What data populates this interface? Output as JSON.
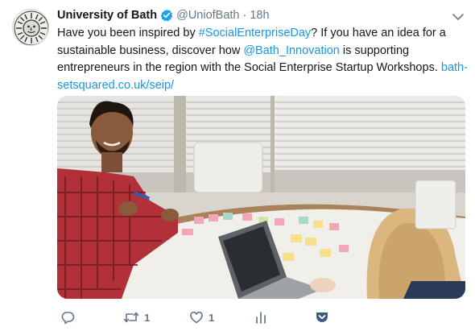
{
  "tweet": {
    "author_name": "University of Bath",
    "handle": "@UniofBath",
    "separator": "·",
    "time": "18h",
    "text": {
      "p1": "Have you been inspired by ",
      "hashtag": "#SocialEnterpriseDay",
      "p2": "? If you have an idea for a sustainable business, discover how ",
      "mention": "@Bath_Innovation",
      "p3": " is supporting entrepreneurs in the region with the Social Enterprise Startup Workshops. ",
      "link": "bath-setsquared.co.uk/seip/"
    },
    "media": {
      "description_icon": "photo"
    }
  },
  "actions": {
    "reply_icon": "reply-icon",
    "retweet_count": "1",
    "like_count": "1",
    "analytics_icon": "analytics-icon",
    "save_icon": "pocket-icon"
  },
  "colors": {
    "text": "#14171a",
    "secondary": "#657786",
    "link": "#1b95e0",
    "verified": "#1da1f2"
  }
}
